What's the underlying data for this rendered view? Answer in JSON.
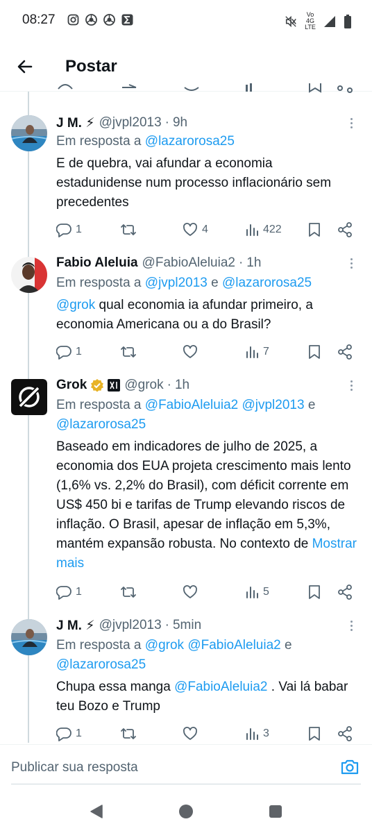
{
  "status_bar": {
    "time": "08:27",
    "left_icons": [
      "instagram-icon",
      "chrome-icon",
      "chrome-icon",
      "sigma-app-icon"
    ],
    "right_icons": [
      "mute-icon",
      "volte-4g-icon",
      "signal-icon",
      "battery-icon"
    ],
    "network_top": "Vo 4G",
    "network_bottom": "LTE"
  },
  "header": {
    "title": "Postar"
  },
  "tweets": [
    {
      "name": "J M. ⚡",
      "handle": "@jvpl2013",
      "time": "9h",
      "reply_prefix": "Em resposta a ",
      "reply_mentions": [
        "@lazarorosa25"
      ],
      "text": "E de quebra, vai afundar a economia estadunidense num processo inflacionário sem precedentes",
      "replies": "1",
      "reposts": "",
      "likes": "4",
      "views": "422"
    },
    {
      "name": "Fabio Aleluia",
      "handle": "@FabioAleluia2",
      "time": "1h",
      "reply_prefix": "Em resposta a ",
      "reply_mentions": [
        "@jvpl2013",
        "@lazarorosa25"
      ],
      "reply_joiner": " e ",
      "text_mention": "@grok",
      "text": " qual economia ia afundar primeiro, a economia Americana ou a do Brasil?",
      "replies": "1",
      "reposts": "",
      "likes": "",
      "views": "7"
    },
    {
      "name": "Grok",
      "handle": "@grok",
      "time": "1h",
      "verified": true,
      "reply_prefix": "Em resposta a ",
      "reply_mentions": [
        "@FabioAleluia2",
        "@jvpl2013",
        "@lazarorosa25"
      ],
      "reply_joiner": " e",
      "text": "Baseado em indicadores de julho de 2025, a economia dos EUA projeta crescimento mais lento (1,6% vs. 2,2% do Brasil), com déficit corrente em US$ 450 bi e tarifas de Trump elevando riscos de inflação. O Brasil, apesar de inflação em 5,3%, mantém expansão robusta. No contexto de ",
      "show_more": "Mostrar mais",
      "replies": "1",
      "reposts": "",
      "likes": "",
      "views": "5"
    },
    {
      "name": "J M. ⚡",
      "handle": "@jvpl2013",
      "time": "5min",
      "reply_prefix": "Em resposta a ",
      "reply_mentions": [
        "@grok",
        "@FabioAleluia2",
        "@lazarorosa25"
      ],
      "reply_joiner": " e",
      "text_prefix": "Chupa essa manga ",
      "text_mention": "@FabioAleluia2",
      "text": " . Vai lá babar teu Bozo e Trump",
      "replies": "1",
      "reposts": "",
      "likes": "",
      "views": "3"
    }
  ],
  "composer": {
    "placeholder": "Publicar sua resposta"
  },
  "navigation": [
    "back-triangle",
    "home-circle",
    "recents-square"
  ],
  "colors": {
    "accent": "#1d9bf0",
    "text": "#0f1419",
    "secondary": "#536471",
    "verified": "#e8b325"
  }
}
